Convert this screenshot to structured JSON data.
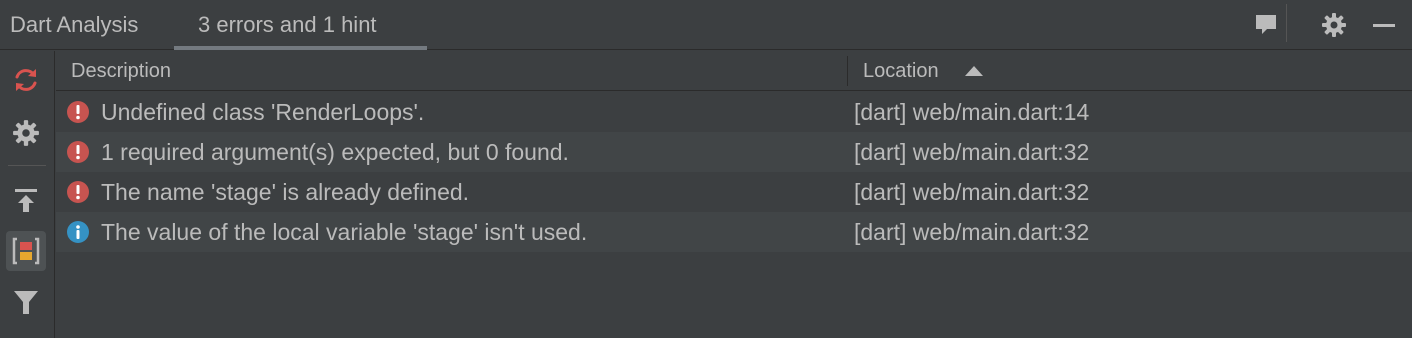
{
  "panel": {
    "title": "Dart Analysis",
    "tab_label": "3 errors and 1 hint"
  },
  "title_actions": [
    {
      "icon": "comment-icon"
    },
    {
      "icon": "gear-icon"
    },
    {
      "icon": "minimize-icon"
    }
  ],
  "toolbar": [
    {
      "icon": "refresh-icon",
      "active": false
    },
    {
      "icon": "gear-icon",
      "active": false
    },
    {
      "icon": "upload-icon",
      "active": false
    },
    {
      "icon": "group-by-severity-icon",
      "active": true
    },
    {
      "icon": "filter-icon",
      "active": false
    }
  ],
  "table": {
    "headers": {
      "description": "Description",
      "location": "Location"
    },
    "sort": {
      "column": "location",
      "direction": "ascending"
    },
    "rows": [
      {
        "severity": "error",
        "description": "Undefined class 'RenderLoops'.",
        "location": "[dart] web/main.dart:14"
      },
      {
        "severity": "error",
        "description": "1 required argument(s) expected, but 0 found.",
        "location": "[dart] web/main.dart:32"
      },
      {
        "severity": "error",
        "description": "The name 'stage' is already defined.",
        "location": "[dart] web/main.dart:32"
      },
      {
        "severity": "info",
        "description": "The value of the local variable 'stage' isn't used.",
        "location": "[dart] web/main.dart:32"
      }
    ]
  },
  "colors": {
    "background": "#3c3f41",
    "alt_row": "#414547",
    "text": "#bbbbbb",
    "error": "#c75450",
    "info": "#3592c4",
    "refresh_accent": "#d9534f"
  }
}
